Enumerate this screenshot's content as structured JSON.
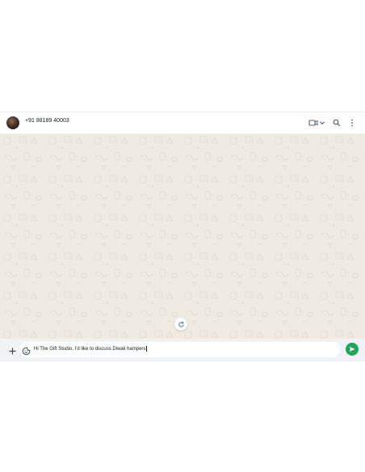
{
  "header": {
    "contact_name": "+91 88189 40003",
    "icons": [
      "video-call-icon",
      "chevron-down-icon",
      "search-icon",
      "more-options-icon"
    ]
  },
  "chat": {
    "refresh_icon": "refresh-icon"
  },
  "composer": {
    "attach_icon": "plus-icon",
    "sticker_icon": "sticker-icon",
    "message_value": "Hi The Gift Studio, I'd like to discuss Diwali hampers",
    "send_icon": "send-icon"
  },
  "colors": {
    "wallpaper": "#efeae2",
    "send_button": "#25a45f",
    "composer_bg": "#f0f2f5",
    "text": "#111b21"
  }
}
